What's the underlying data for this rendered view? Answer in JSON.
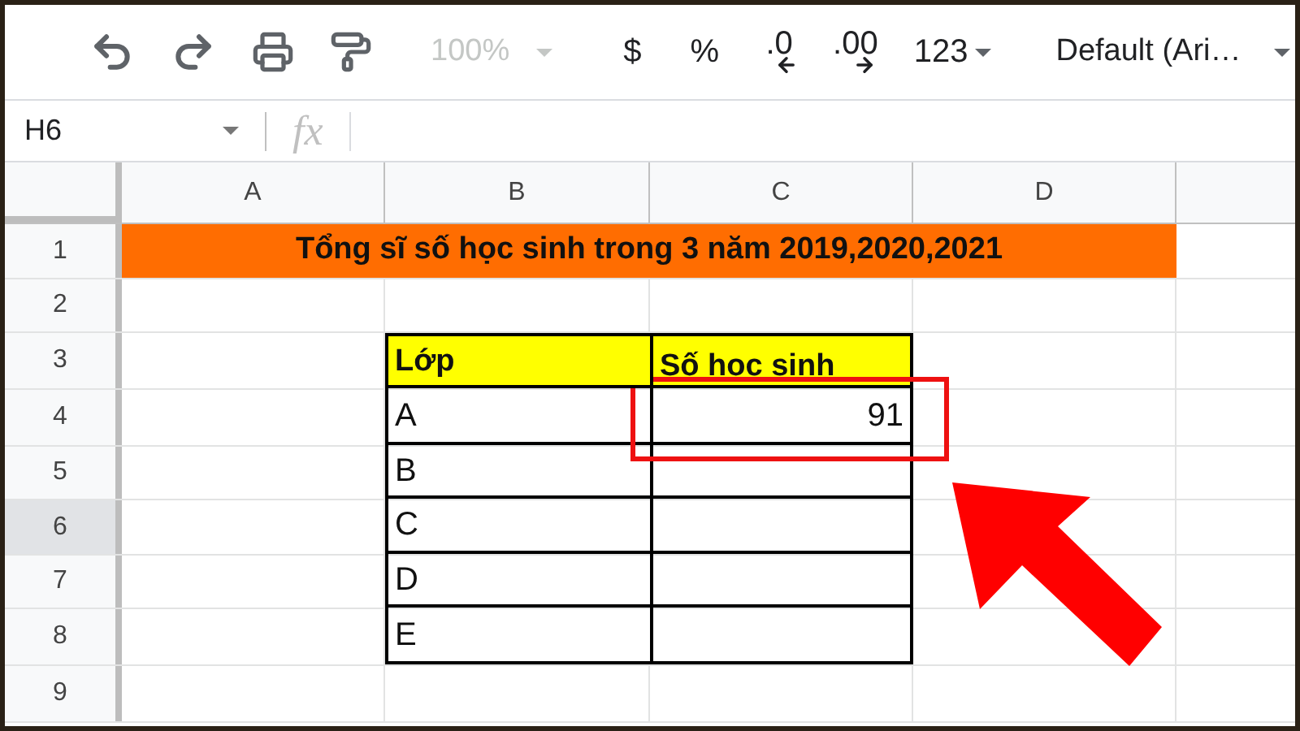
{
  "toolbar": {
    "zoom": {
      "value": "100%",
      "disabled": true
    },
    "format_buttons": [
      {
        "label": "$",
        "kind": "plain"
      },
      {
        "label": "%",
        "kind": "plain"
      },
      {
        "label": ".0",
        "kind": "decrease"
      },
      {
        "label": ".00",
        "kind": "increase"
      },
      {
        "label": "123",
        "kind": "dropdown"
      }
    ],
    "font": "Default (Ari…"
  },
  "formula_bar": {
    "name_box": "H6",
    "fx": "fx"
  },
  "columns": [
    "A",
    "B",
    "C",
    "D"
  ],
  "rows": [
    {
      "number": "1",
      "selected": false
    },
    {
      "number": "2",
      "selected": false
    },
    {
      "number": "3",
      "selected": false
    },
    {
      "number": "4",
      "selected": false
    },
    {
      "number": "5",
      "selected": false
    },
    {
      "number": "6",
      "selected": true
    },
    {
      "number": "7",
      "selected": false
    },
    {
      "number": "8",
      "selected": false
    },
    {
      "number": "9",
      "selected": false
    }
  ],
  "title": "Tổng sĩ số học sinh trong 3 năm 2019,2020,2021",
  "table": {
    "headers": [
      "Lớp",
      "Số học sinh"
    ],
    "rows": [
      {
        "class": "A",
        "count": "91"
      },
      {
        "class": "B"
      },
      {
        "class": "C"
      },
      {
        "class": "D"
      },
      {
        "class": "E"
      }
    ]
  }
}
